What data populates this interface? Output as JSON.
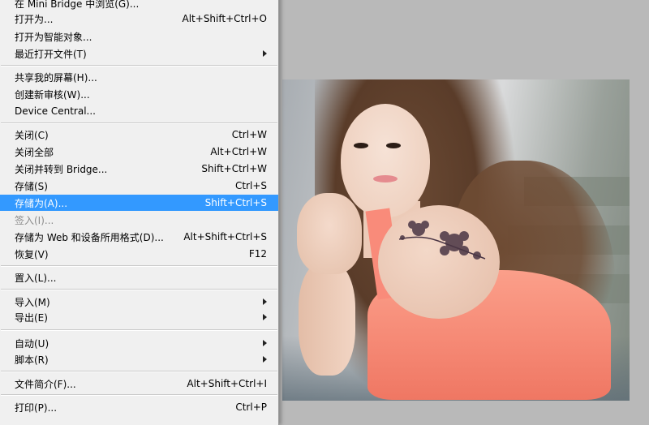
{
  "file_menu": {
    "items": [
      {
        "label": "在 Mini Bridge 中浏览(G)...",
        "shortcut": ""
      },
      {
        "label": "打开为...",
        "shortcut": "Alt+Shift+Ctrl+O"
      },
      {
        "label": "打开为智能对象...",
        "shortcut": ""
      },
      {
        "label": "最近打开文件(T)",
        "shortcut": "",
        "submenu": true
      },
      {
        "label": "共享我的屏幕(H)...",
        "shortcut": ""
      },
      {
        "label": "创建新审核(W)...",
        "shortcut": ""
      },
      {
        "label": "Device Central...",
        "shortcut": ""
      },
      {
        "label": "关闭(C)",
        "shortcut": "Ctrl+W"
      },
      {
        "label": "关闭全部",
        "shortcut": "Alt+Ctrl+W"
      },
      {
        "label": "关闭并转到 Bridge...",
        "shortcut": "Shift+Ctrl+W"
      },
      {
        "label": "存储(S)",
        "shortcut": "Ctrl+S"
      },
      {
        "label": "存储为(A)...",
        "shortcut": "Shift+Ctrl+S",
        "highlighted": true
      },
      {
        "label": "签入(I)...",
        "shortcut": "",
        "disabled": true
      },
      {
        "label": "存储为 Web 和设备所用格式(D)...",
        "shortcut": "Alt+Shift+Ctrl+S"
      },
      {
        "label": "恢复(V)",
        "shortcut": "F12"
      },
      {
        "label": "置入(L)...",
        "shortcut": ""
      },
      {
        "label": "导入(M)",
        "shortcut": "",
        "submenu": true
      },
      {
        "label": "导出(E)",
        "shortcut": "",
        "submenu": true
      },
      {
        "label": "自动(U)",
        "shortcut": "",
        "submenu": true
      },
      {
        "label": "脚本(R)",
        "shortcut": "",
        "submenu": true
      },
      {
        "label": "文件简介(F)...",
        "shortcut": "Alt+Shift+Ctrl+I"
      },
      {
        "label": "打印(P)...",
        "shortcut": "Ctrl+P"
      }
    ]
  },
  "colors": {
    "menu_background": "#f0f0f0",
    "highlight": "#3399ff",
    "workspace": "#b9b9b9",
    "disabled_text": "#8b8b8b"
  }
}
